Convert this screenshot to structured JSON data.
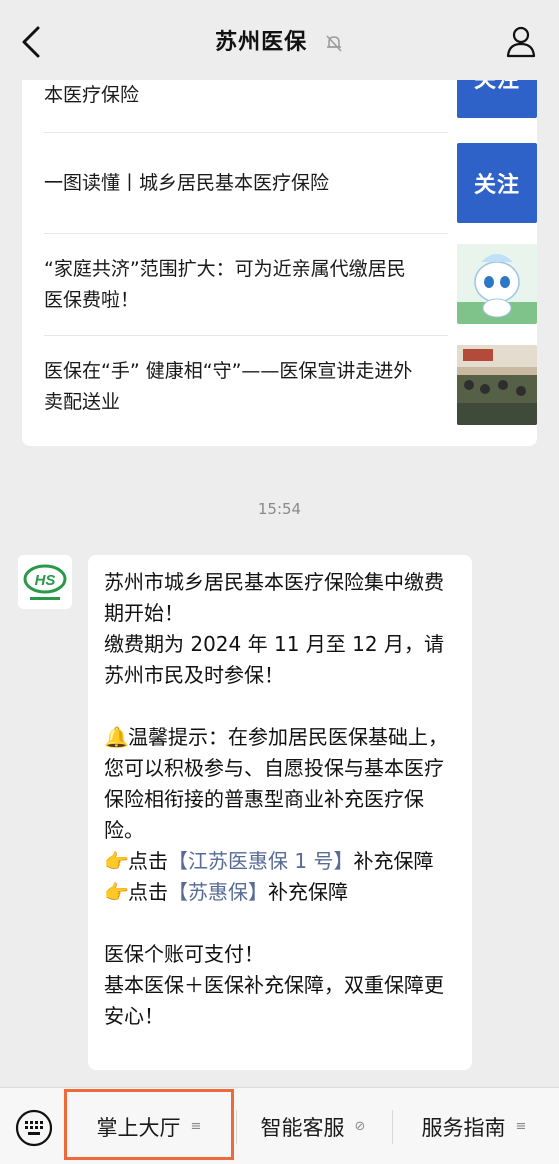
{
  "header": {
    "title": "苏州医保",
    "back_icon": "chevron-left-icon",
    "mute_icon": "bell-off-icon",
    "profile_icon": "person-icon"
  },
  "articles": [
    {
      "title": "本医疗保险",
      "thumb": "follow-banner",
      "thumb_label": "关注"
    },
    {
      "title": "一图读懂丨城乡居民基本医疗保险",
      "thumb": "follow-banner",
      "thumb_label": "关注"
    },
    {
      "title": "“家庭共济”范围扩大：可为近亲属代缴居民医保费啦！",
      "thumb": "mascot-image"
    },
    {
      "title": "医保在“手” 健康相“守”——医保宣讲走进外卖配送业",
      "thumb": "meeting-photo"
    }
  ],
  "timestamp": "15:54",
  "message": {
    "avatar": "HS logo",
    "lines": {
      "l1": "苏州市城乡居民基本医疗保险集中缴费期开始！",
      "l2": "缴费期为 2024 年 11 月至 12 月，请苏州市民及时参保！",
      "tip_emoji": "🔔",
      "tip": "温馨提示：在参加居民医保基础上，您可以积极参与、自愿投保与基本医疗保险相衔接的普惠型商业补充医疗保险。",
      "hand_emoji": "👉",
      "click_prefix": "点击",
      "link1": "【江苏医惠保 1 号】",
      "link1_suffix": "补充保障",
      "link2": "【苏惠保】",
      "link2_suffix": "补充保障",
      "l5": "医保个账可支付！",
      "l6": "基本医保＋医保补充保障，双重保障更安心！"
    }
  },
  "menu": {
    "keyboard_icon": "keyboard-icon",
    "items": [
      {
        "label": "掌上大厅",
        "icon": "≡"
      },
      {
        "label": "智能客服",
        "icon": "⊘"
      },
      {
        "label": "服务指南",
        "icon": "≡"
      }
    ],
    "highlight_color": "#ef6a3a"
  }
}
